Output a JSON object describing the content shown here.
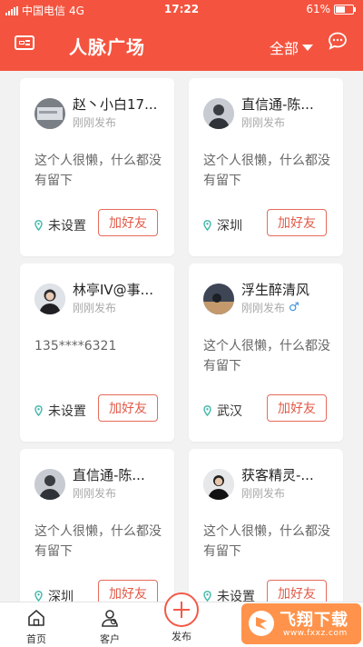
{
  "status_bar": {
    "carrier": "中国电信",
    "network": "4G",
    "time": "17:22",
    "battery": "61%",
    "battery_level": 0.61
  },
  "header": {
    "title": "人脉广场",
    "filter_label": "全部",
    "accent": "#f4543f"
  },
  "cards": [
    {
      "name": "赵丶小白17...",
      "time": "刚刚发布",
      "bio": "这个人很懒，什么都没有留下",
      "location": "未设置",
      "add_label": "加好友"
    },
    {
      "name": "直信通-陈...",
      "time": "刚刚发布",
      "bio": "这个人很懒，什么都没有留下",
      "location": "深圳",
      "add_label": "加好友"
    },
    {
      "name": "林亭IV@事...",
      "time": "刚刚发布",
      "bio": "135****6321",
      "location": "未设置",
      "add_label": "加好友"
    },
    {
      "name": "浮生醉清风",
      "time": "刚刚发布",
      "gender": "♂",
      "bio": "这个人很懒，什么都没有留下",
      "location": "武汉",
      "add_label": "加好友"
    },
    {
      "name": "直信通-陈...",
      "time": "刚刚发布",
      "bio": "这个人很懒，什么都没有留下",
      "location": "深圳",
      "add_label": "加好友"
    },
    {
      "name": "获客精灵-...",
      "time": "刚刚发布",
      "bio": "这个人很懒，什么都没有留下",
      "location": "未设置",
      "add_label": "加好友"
    }
  ],
  "tabbar": {
    "home": "首页",
    "customers": "客户",
    "publish": "发布"
  },
  "watermark": {
    "title": "飞翔下载",
    "url": "www.fxxz.com"
  }
}
